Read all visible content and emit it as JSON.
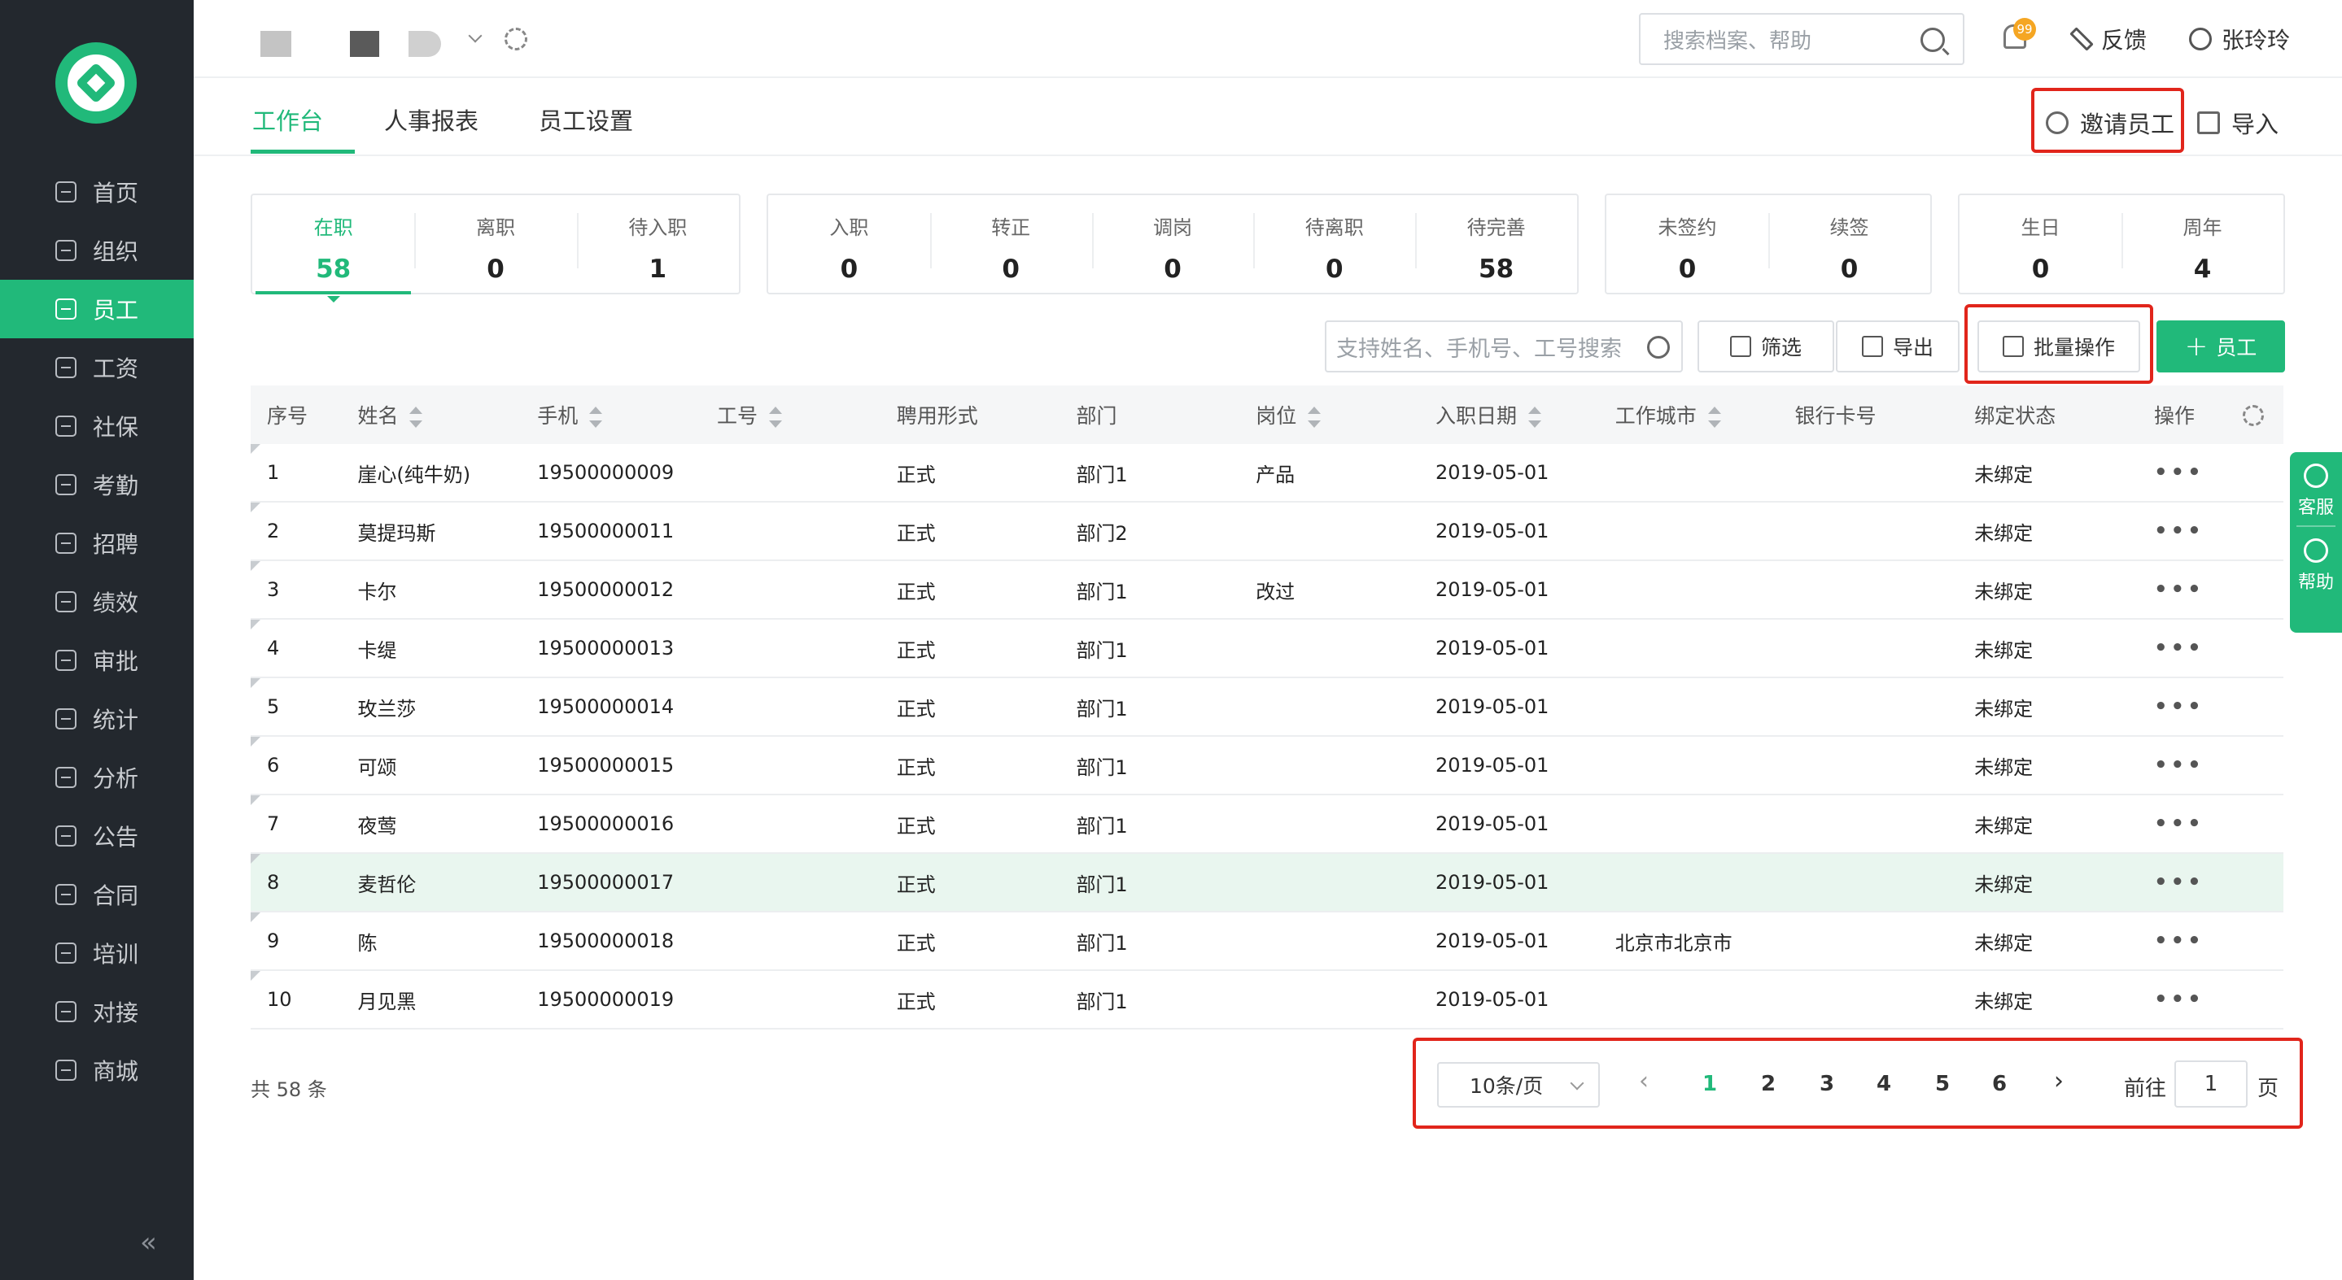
{
  "sidebar": {
    "items": [
      {
        "label": "首页",
        "icon": "home-icon"
      },
      {
        "label": "组织",
        "icon": "org-icon"
      },
      {
        "label": "员工",
        "icon": "employee-icon"
      },
      {
        "label": "工资",
        "icon": "salary-icon"
      },
      {
        "label": "社保",
        "icon": "insurance-icon"
      },
      {
        "label": "考勤",
        "icon": "attendance-icon"
      },
      {
        "label": "招聘",
        "icon": "recruit-icon"
      },
      {
        "label": "绩效",
        "icon": "performance-icon"
      },
      {
        "label": "审批",
        "icon": "approval-icon"
      },
      {
        "label": "统计",
        "icon": "stats-icon"
      },
      {
        "label": "分析",
        "icon": "analysis-icon"
      },
      {
        "label": "公告",
        "icon": "notice-icon"
      },
      {
        "label": "合同",
        "icon": "contract-icon"
      },
      {
        "label": "培训",
        "icon": "training-icon"
      },
      {
        "label": "对接",
        "icon": "integration-icon"
      },
      {
        "label": "商城",
        "icon": "store-icon"
      }
    ],
    "active_index": 2,
    "collapse_glyph": "«"
  },
  "header": {
    "search_placeholder": "搜索档案、帮助",
    "notification_badge": "99",
    "feedback_label": "反馈",
    "user_name": "张玲玲"
  },
  "tabs": [
    {
      "label": "工作台",
      "active": true
    },
    {
      "label": "人事报表",
      "active": false
    },
    {
      "label": "员工设置",
      "active": false
    }
  ],
  "top_actions": {
    "invite_label": "邀请员工",
    "import_label": "导入"
  },
  "stat_cards": [
    [
      {
        "label": "在职",
        "value": "58",
        "active": true
      },
      {
        "label": "离职",
        "value": "0"
      },
      {
        "label": "待入职",
        "value": "1"
      }
    ],
    [
      {
        "label": "入职",
        "value": "0"
      },
      {
        "label": "转正",
        "value": "0"
      },
      {
        "label": "调岗",
        "value": "0"
      },
      {
        "label": "待离职",
        "value": "0"
      },
      {
        "label": "待完善",
        "value": "58"
      }
    ],
    [
      {
        "label": "未签约",
        "value": "0"
      },
      {
        "label": "续签",
        "value": "0"
      }
    ],
    [
      {
        "label": "生日",
        "value": "0"
      },
      {
        "label": "周年",
        "value": "4"
      }
    ]
  ],
  "toolbar": {
    "search_placeholder": "支持姓名、手机号、工号搜索",
    "filter_label": "筛选",
    "export_label": "导出",
    "batch_label": "批量操作",
    "add_label": "员工",
    "add_glyph": "+"
  },
  "table": {
    "headers": [
      "序号",
      "姓名",
      "手机",
      "工号",
      "聘用形式",
      "部门",
      "岗位",
      "入职日期",
      "工作城市",
      "银行卡号",
      "绑定状态",
      "操作"
    ],
    "sortable": [
      false,
      true,
      true,
      true,
      false,
      false,
      true,
      true,
      true,
      false,
      false,
      false
    ],
    "rows": [
      [
        "1",
        "崖心(纯牛奶)",
        "19500000009",
        "",
        "正式",
        "部门1",
        "产品",
        "2019-05-01",
        "",
        "",
        "未绑定",
        "•••"
      ],
      [
        "2",
        "莫提玛斯",
        "19500000011",
        "",
        "正式",
        "部门2",
        "",
        "2019-05-01",
        "",
        "",
        "未绑定",
        "•••"
      ],
      [
        "3",
        "卡尔",
        "19500000012",
        "",
        "正式",
        "部门1",
        "改过",
        "2019-05-01",
        "",
        "",
        "未绑定",
        "•••"
      ],
      [
        "4",
        "卡缇",
        "19500000013",
        "",
        "正式",
        "部门1",
        "",
        "2019-05-01",
        "",
        "",
        "未绑定",
        "•••"
      ],
      [
        "5",
        "玫兰莎",
        "19500000014",
        "",
        "正式",
        "部门1",
        "",
        "2019-05-01",
        "",
        "",
        "未绑定",
        "•••"
      ],
      [
        "6",
        "可颂",
        "19500000015",
        "",
        "正式",
        "部门1",
        "",
        "2019-05-01",
        "",
        "",
        "未绑定",
        "•••"
      ],
      [
        "7",
        "夜莺",
        "19500000016",
        "",
        "正式",
        "部门1",
        "",
        "2019-05-01",
        "",
        "",
        "未绑定",
        "•••"
      ],
      [
        "8",
        "麦哲伦",
        "19500000017",
        "",
        "正式",
        "部门1",
        "",
        "2019-05-01",
        "",
        "",
        "未绑定",
        "•••"
      ],
      [
        "9",
        "陈",
        "19500000018",
        "",
        "正式",
        "部门1",
        "",
        "2019-05-01",
        "北京市北京市",
        "",
        "未绑定",
        "•••"
      ],
      [
        "10",
        "月见黑",
        "19500000019",
        "",
        "正式",
        "部门1",
        "",
        "2019-05-01",
        "",
        "",
        "未绑定",
        "•••"
      ]
    ],
    "highlighted_row": 7
  },
  "footer": {
    "total_text": "共 58 条",
    "page_size": "10条/页",
    "prev_glyph": "‹",
    "next_glyph": "›",
    "pages": [
      "1",
      "2",
      "3",
      "4",
      "5",
      "6"
    ],
    "current_page": "1",
    "goto_label": "前往",
    "goto_value": "1",
    "page_suffix": "页"
  },
  "float_panel": {
    "service_label": "客服",
    "help_label": "帮助"
  },
  "colors": {
    "accent": "#21b97a",
    "sidebar_bg": "#23282e",
    "highlight_row": "#e9f6ef",
    "annotation_red": "#e1251b"
  }
}
